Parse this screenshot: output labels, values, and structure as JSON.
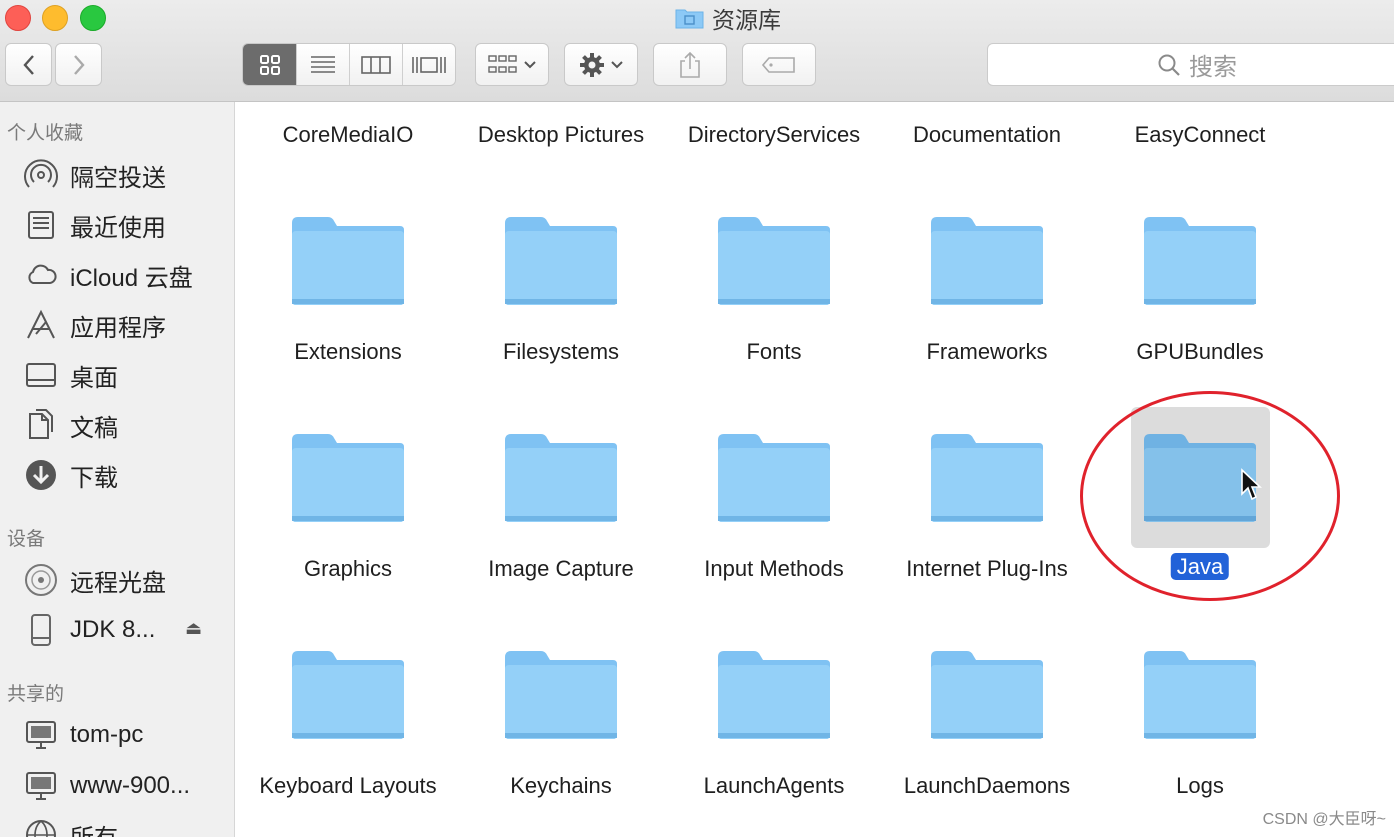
{
  "window": {
    "title": "资源库"
  },
  "toolbar": {
    "back": "‹",
    "forward": "›",
    "search_placeholder": "搜索"
  },
  "sidebar": {
    "favorites_header": "个人收藏",
    "favorites": [
      {
        "label": "隔空投送",
        "icon": "airdrop-icon"
      },
      {
        "label": "最近使用",
        "icon": "recents-icon"
      },
      {
        "label": "iCloud 云盘",
        "icon": "cloud-icon"
      },
      {
        "label": "应用程序",
        "icon": "applications-icon"
      },
      {
        "label": "桌面",
        "icon": "desktop-icon"
      },
      {
        "label": "文稿",
        "icon": "documents-icon"
      },
      {
        "label": "下载",
        "icon": "downloads-icon"
      }
    ],
    "devices_header": "设备",
    "devices": [
      {
        "label": "远程光盘",
        "icon": "disc-icon"
      },
      {
        "label": "JDK 8...",
        "icon": "drive-icon"
      }
    ],
    "shared_header": "共享的",
    "shared": [
      {
        "label": "tom-pc",
        "icon": "computer-icon"
      },
      {
        "label": "www-900...",
        "icon": "computer-icon"
      },
      {
        "label": "所有...",
        "icon": "network-icon"
      }
    ]
  },
  "files": {
    "row0": [
      "CoreMediaIO",
      "Desktop Pictures",
      "DirectoryServices",
      "Documentation",
      "EasyConnect"
    ],
    "row1": [
      "Extensions",
      "Filesystems",
      "Fonts",
      "Frameworks",
      "GPUBundles"
    ],
    "row2": [
      "Graphics",
      "Image Capture",
      "Input Methods",
      "Internet Plug-Ins",
      "Java"
    ],
    "row3": [
      "Keyboard Layouts",
      "Keychains",
      "LaunchAgents",
      "LaunchDaemons",
      "Logs"
    ],
    "selected": "Java"
  },
  "watermark": "CSDN @大臣呀~",
  "colors": {
    "folder": "#8cc9f6",
    "selection": "#2262d8",
    "annotation": "#e0222c"
  }
}
